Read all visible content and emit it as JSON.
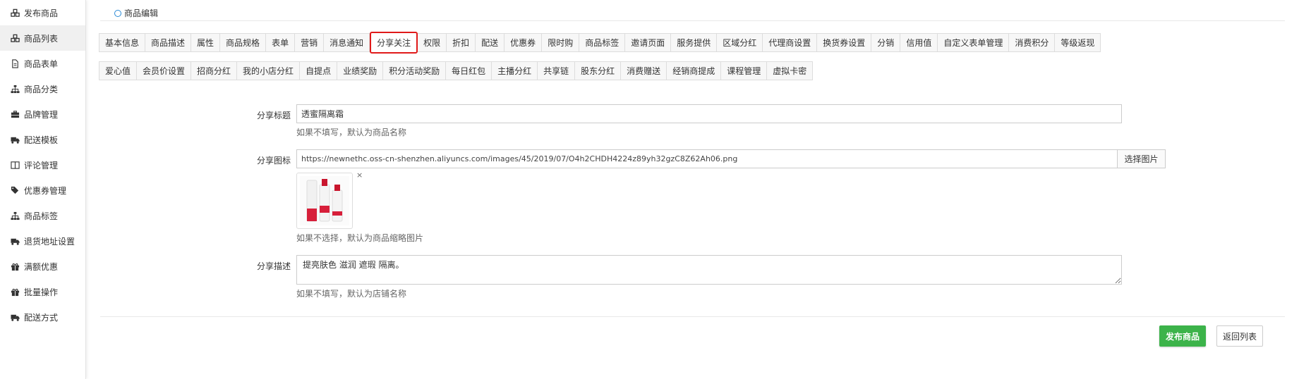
{
  "sidebar": {
    "items": [
      {
        "label": "发布商品",
        "icon": "cubes-icon",
        "active": false
      },
      {
        "label": "商品列表",
        "icon": "cubes-icon",
        "active": true
      },
      {
        "label": "商品表单",
        "icon": "file-icon",
        "active": false
      },
      {
        "label": "商品分类",
        "icon": "sitemap-icon",
        "active": false
      },
      {
        "label": "品牌管理",
        "icon": "briefcase-icon",
        "active": false
      },
      {
        "label": "配送模板",
        "icon": "truck-icon",
        "active": false
      },
      {
        "label": "评论管理",
        "icon": "book-icon",
        "active": false
      },
      {
        "label": "优惠券管理",
        "icon": "tags-icon",
        "active": false
      },
      {
        "label": "商品标签",
        "icon": "sitemap-icon",
        "active": false
      },
      {
        "label": "退货地址设置",
        "icon": "truck-icon",
        "active": false
      },
      {
        "label": "满额优惠",
        "icon": "gift-icon",
        "active": false
      },
      {
        "label": "批量操作",
        "icon": "gift-icon",
        "active": false
      },
      {
        "label": "配送方式",
        "icon": "truck-icon",
        "active": false
      }
    ]
  },
  "breadcrumb": {
    "label": "商品编辑"
  },
  "tabs": {
    "row1": [
      "基本信息",
      "商品描述",
      "属性",
      "商品规格",
      "表单",
      "营销",
      "消息通知",
      "分享关注",
      "权限",
      "折扣",
      "配送",
      "优惠券",
      "限时购",
      "商品标签",
      "邀请页面",
      "服务提供",
      "区域分红",
      "代理商设置",
      "换货券设置",
      "分销",
      "信用值",
      "自定义表单管理",
      "消费积分",
      "等级返现"
    ],
    "row2": [
      "爱心值",
      "会员价设置",
      "招商分红",
      "我的小店分红",
      "自提点",
      "业绩奖励",
      "积分活动奖励",
      "每日红包",
      "主播分红",
      "共享链",
      "股东分红",
      "消费赠送",
      "经销商提成",
      "课程管理",
      "虚拟卡密"
    ],
    "active": "分享关注"
  },
  "form": {
    "share_title": {
      "label": "分享标题",
      "value": "透蜜隔离霜",
      "hint": "如果不填写，默认为商品名称"
    },
    "share_icon": {
      "label": "分享图标",
      "value": "https://newnethc.oss-cn-shenzhen.aliyuncs.com/images/45/2019/07/O4h2CHDH4224z89yh32gzC8Z62Ah06.png",
      "button": "选择图片",
      "remove": "×",
      "hint": "如果不选择，默认为商品缩略图片"
    },
    "share_desc": {
      "label": "分享描述",
      "value": "提亮肤色 滋润 遮瑕 隔离。",
      "hint": "如果不填写，默认为店铺名称"
    }
  },
  "actions": {
    "publish": "发布商品",
    "back": "返回列表"
  },
  "colors": {
    "accent_green": "#3cb34a",
    "active_tab_border": "#e01a1a",
    "breadcrumb_ring": "#2a8ad6"
  }
}
